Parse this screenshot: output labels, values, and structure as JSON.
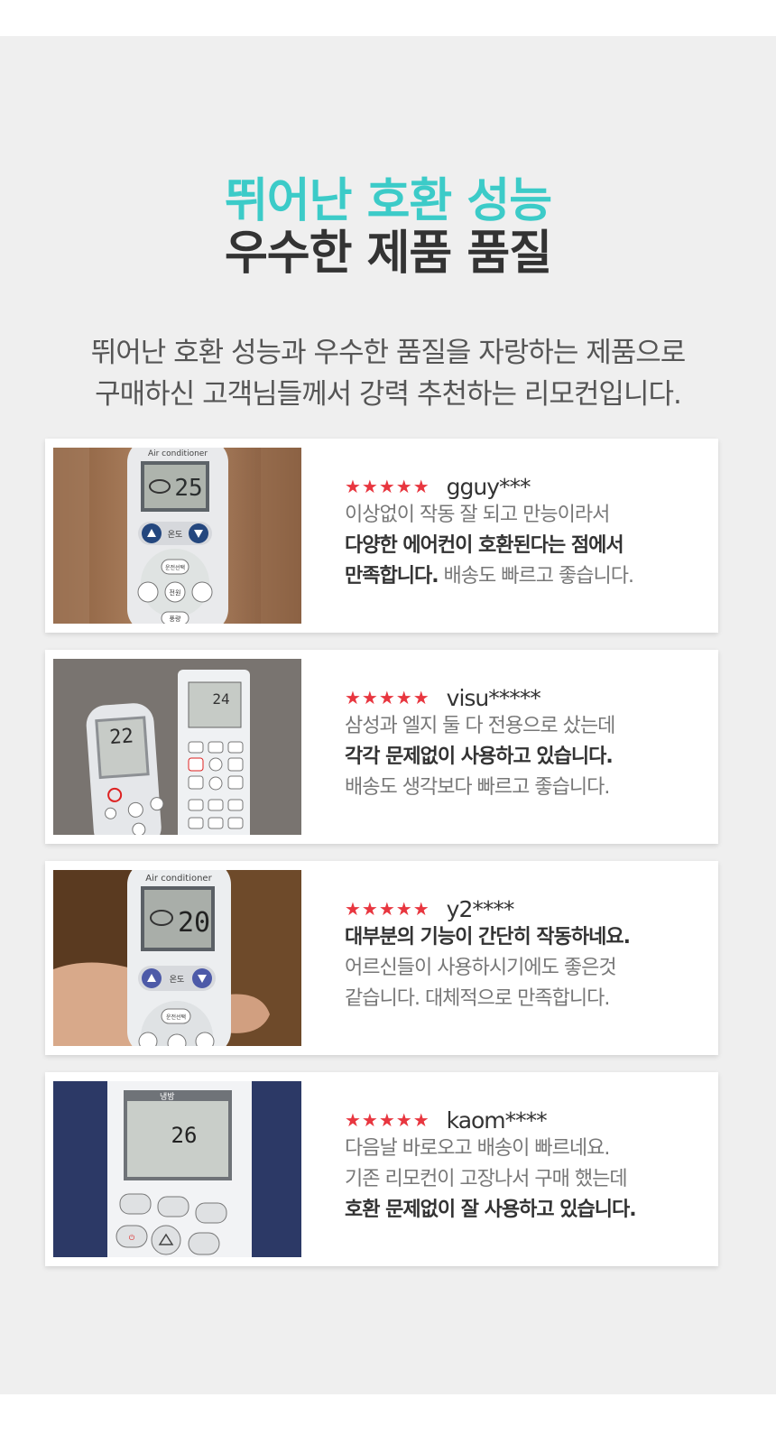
{
  "headline": {
    "line1": "뛰어난 호환 성능",
    "line2": "우수한 제품 품질"
  },
  "intro": {
    "line1": "뛰어난 호환 성능과 우수한 품질을 자랑하는 제품으로",
    "line2": "구매하신 고객님들께서 강력 추천하는 리모컨입니다."
  },
  "colors": {
    "accent": "#3ccbc8",
    "star": "#e8363f",
    "dark": "#333333",
    "background": "#efefef"
  },
  "reviews": [
    {
      "rating": 5,
      "stars": "★★★★★",
      "user": "gguy***",
      "photo_labels": {
        "brand": "Air conditioner",
        "temp": "25",
        "temp_btn": "온도",
        "b1": "운전선택",
        "b2": "상하\n바람",
        "b3": "전원",
        "b4": "좌우\n바람",
        "b5": "풍량"
      },
      "l1": "이상없이 작동 잘 되고 만능이라서",
      "l2": "다양한 에어컨이 호환된다는 점에서",
      "l3a": "만족합니다.",
      "l3b": " 배송도 빠르고 좋습니다."
    },
    {
      "rating": 5,
      "stars": "★★★★★",
      "user": "visu*****",
      "photo_labels": {
        "temp_a": "22",
        "temp_b": "24"
      },
      "l1": "삼성과 엘지 둘 다 전용으로 샀는데",
      "l2": "각각 문제없이 사용하고 있습니다.",
      "l3": "배송도 생각보다 빠르고 좋습니다."
    },
    {
      "rating": 5,
      "stars": "★★★★★",
      "user": "y2****",
      "photo_labels": {
        "brand": "Air conditioner",
        "temp": "20",
        "temp_btn": "온도",
        "b1": "운전선택"
      },
      "l1": "대부분의 기능이 간단히 작동하네요.",
      "l2": "어르신들이 사용하시기에도 좋은것",
      "l3": "같습니다. 대체적으로 만족합니다."
    },
    {
      "rating": 5,
      "stars": "★★★★★",
      "user": "kaom****",
      "photo_labels": {
        "mode": "냉방",
        "temp": "26",
        "b1": "공기\n청정",
        "b2": "바람각\n조절",
        "b3": "파워\n냉방",
        "b4": "운전\n정지",
        "b5": "운전\n선택"
      },
      "l1": "다음날 바로오고 배송이 빠르네요.",
      "l2": "기존 리모컨이 고장나서 구매 했는데",
      "l3": "호환 문제없이 잘 사용하고 있습니다."
    }
  ]
}
